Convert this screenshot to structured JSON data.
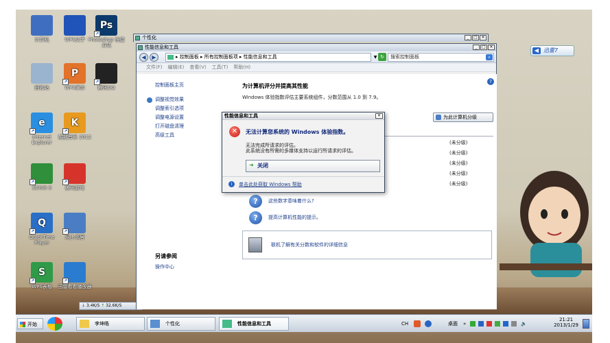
{
  "desktop": {
    "icons": [
      {
        "label": "计算机",
        "icon": "computer-icon",
        "color": "#3f6ec0"
      },
      {
        "label": "WPS文字",
        "icon": "wps-writer-icon",
        "color": "#2154b8"
      },
      {
        "label": "Photoshop 快捷方式",
        "icon": "photoshop-icon",
        "color": "#0d3a6d",
        "glyph": "Ps"
      },
      {
        "label": "回收站",
        "icon": "recycle-bin-icon",
        "color": "#9ab4cf"
      },
      {
        "label": "WPS演示",
        "icon": "wps-presentation-icon",
        "color": "#e3732a",
        "glyph": "P"
      },
      {
        "label": "腾讯QQ",
        "icon": "qq-penguin-icon",
        "color": "#222222"
      },
      {
        "label": "Internet Explorer",
        "icon": "ie-icon",
        "color": "#2a8fe0",
        "glyph": "e"
      },
      {
        "label": "酷我音乐 2012",
        "icon": "kuwo-icon",
        "color": "#e89a1e",
        "glyph": "K"
      },
      {
        "label": "EDIUS 6",
        "icon": "edius-icon",
        "color": "#2f8f3a"
      },
      {
        "label": "腾讯游戏",
        "icon": "game-cube-icon",
        "color": "#d6342b"
      },
      {
        "label": "QuickTime Player",
        "icon": "quicktime-icon",
        "color": "#2a6fc7",
        "glyph": "Q"
      },
      {
        "label": "网上邻居",
        "icon": "network-icon",
        "color": "#4a7dc4"
      },
      {
        "label": "WPS表格",
        "icon": "wps-spreadsheet-icon",
        "color": "#2f9a48",
        "glyph": "S"
      },
      {
        "label": "迅雷看看播放器",
        "icon": "xunlei-player-icon",
        "color": "#2a7cd0"
      }
    ],
    "xunlei_badge": "迅雷7",
    "netspeed_down": "3.4K/S",
    "netspeed_up": "32.6K/S"
  },
  "window_back": {
    "title": "个性化"
  },
  "window": {
    "title": "性能信息和工具",
    "breadcrumb": "▸ 控制面板 ▸ 所有控制面板项 ▸ 性能信息和工具",
    "search_placeholder": "搜索控制面板",
    "menu": [
      "文件(F)",
      "编辑(E)",
      "查看(V)",
      "工具(T)",
      "帮助(H)"
    ],
    "sidebar": {
      "home": "控制面板主页",
      "links": [
        "调整视觉效果",
        "调整索引选项",
        "调整电源设置",
        "打开磁盘清理",
        "高级工具"
      ],
      "see_also": "另请参阅",
      "see_also_links": [
        "操作中心"
      ]
    },
    "main": {
      "heading": "为计算机评分并提高其性能",
      "description": "Windows 体验指数评估主要系统组件，分数范围从 1.0 到 7.9。",
      "rate_button": "为此计算机分级",
      "scores": [
        "(未分级)",
        "(未分级)",
        "(未分级)",
        "(未分级)",
        "(未分级)"
      ],
      "help_links": [
        "这些数字意味着什么?",
        "提高计算机性能的提示。"
      ],
      "online_link": "联机了解有关分数和软件的详细信息"
    }
  },
  "dialog": {
    "title": "性能信息和工具",
    "heading": "无法计算您系统的 Windows 体验指数。",
    "message1": "无法完成所请求的评估。",
    "message2": "此系统没有所需的多媒体支持以运行所请求的评估。",
    "close_button": "关闭",
    "help_link": "单击此处获取 Windows 帮助"
  },
  "taskbar": {
    "start": "开始",
    "buttons": [
      "李坤皓",
      "个性化",
      "性能信息和工具"
    ],
    "tray": {
      "ime": "CH",
      "desktop_label": "桌面",
      "time": "21:21",
      "date": "2013/1/29"
    }
  }
}
